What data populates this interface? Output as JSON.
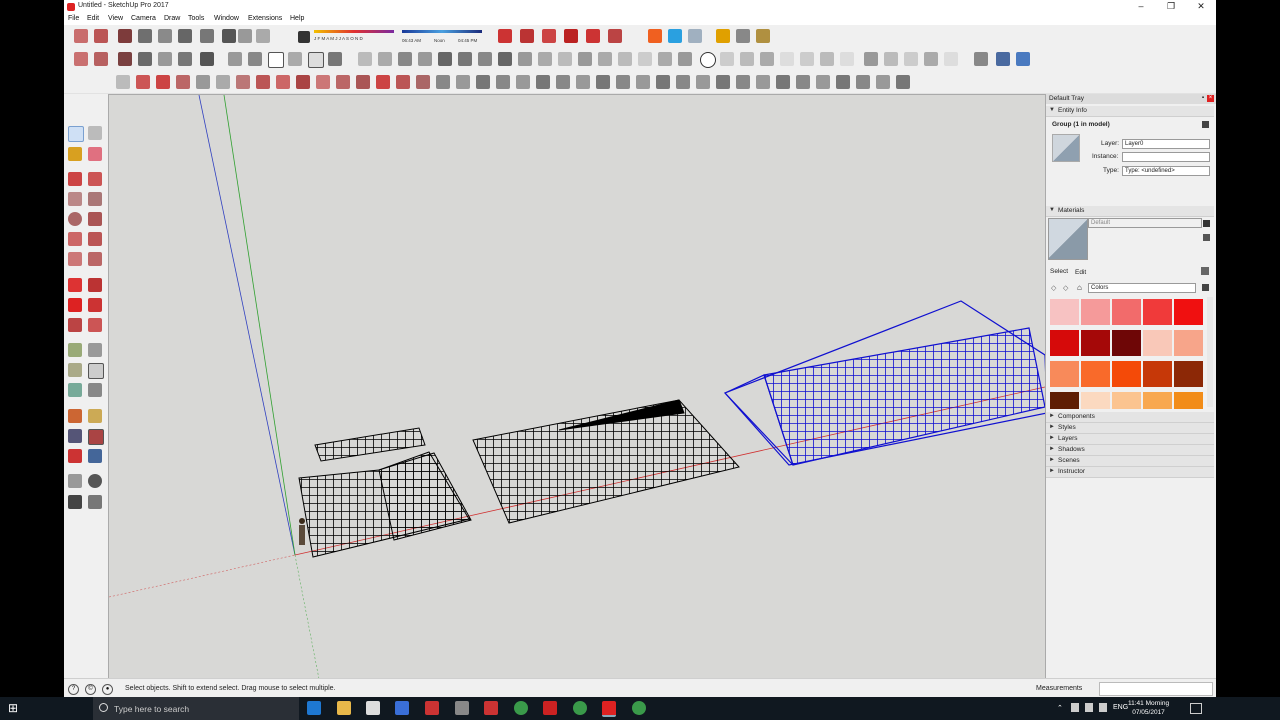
{
  "window": {
    "title": "Untitled - SketchUp Pro 2017"
  },
  "menubar": {
    "items": [
      "File",
      "Edit",
      "View",
      "Camera",
      "Draw",
      "Tools",
      "Window",
      "Extensions",
      "Help"
    ]
  },
  "shadow_widget": {
    "months": "J F M A M J J A S O N D",
    "time_start": "06:43 AM",
    "time_noon": "Noon",
    "time_end": "04:45 PM"
  },
  "tray": {
    "title": "Default Tray",
    "entity_info": {
      "header": "Entity Info",
      "group": "Group (1 in model)",
      "layer_label": "Layer:",
      "layer_value": "Layer0",
      "instance_label": "Instance:",
      "instance_value": "",
      "type_label": "Type:",
      "type_value": "Type: <undefined>"
    },
    "materials": {
      "header": "Materials",
      "default_name": "Default",
      "tab_select": "Select",
      "tab_edit": "Edit",
      "library": "Colors",
      "swatches": [
        "#f7c2c2",
        "#f59a9a",
        "#f26b6b",
        "#f03a3a",
        "#f01010",
        "#d60a0a",
        "#a50808",
        "#6e0606",
        "#f9c8b8",
        "#f7a58a",
        "#f88a5a",
        "#f96a2a",
        "#f44a08",
        "#c63808",
        "#8c2806",
        "#5e1e04",
        "#fbd9c0",
        "#fbc490",
        "#f8a850",
        "#f28c18"
      ]
    },
    "collapsed_panels": [
      "Components",
      "Styles",
      "Layers",
      "Shadows",
      "Scenes",
      "Instructor"
    ]
  },
  "status": {
    "message": "Select objects. Shift to extend select. Drag mouse to select multiple.",
    "measurements_label": "Measurements"
  },
  "taskbar": {
    "search_placeholder": "Type here to search",
    "language": "ENG",
    "time": "11:41 Morning",
    "date": "07/05/2017"
  }
}
